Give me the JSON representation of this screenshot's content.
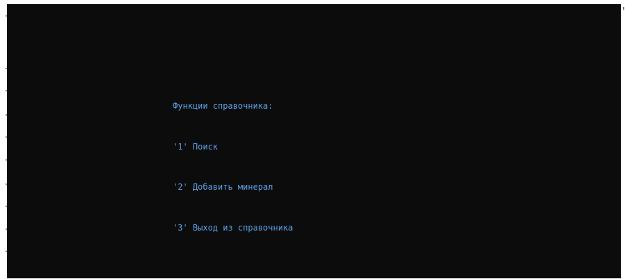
{
  "console": {
    "menu_title": "Функции справочника:",
    "options": [
      "'1' Поиск",
      "'2' Добавить минерал",
      "'3' Выход из справочника"
    ],
    "text_color": "#5aa0e6",
    "background_color": "#0c0c0c"
  }
}
